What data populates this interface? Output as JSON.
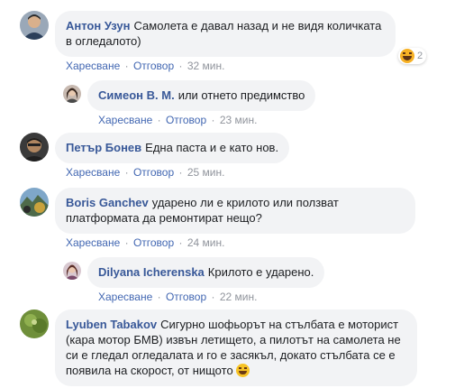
{
  "actions": {
    "like": "Харесване",
    "reply": "Отговор",
    "separator": "·"
  },
  "comments": [
    {
      "author": "Антон Узун",
      "text": "Самолета е давал назад и не видя количката в огледалото)",
      "time": "32 мин.",
      "reaction_count": "2",
      "reaction_icon": "haha-reaction-icon"
    },
    {
      "author": "Симеон В. М.",
      "text": "или отнето предимство",
      "time": "23 мин."
    },
    {
      "author": "Петър Бонев",
      "text": "Една паста и е като нов.",
      "time": "25 мин."
    },
    {
      "author": "Boris Ganchev",
      "text": "ударено ли е крилото или ползват платформата да ремонтират нещо?",
      "time": "24 мин."
    },
    {
      "author": "Dilyana Icherenska",
      "text": "Крилото е ударено.",
      "time": "22 мин."
    },
    {
      "author": "Lyuben Tabakov",
      "text": "Сигурно шофьорът на стълбата е моторист (кара мотор БМВ) извън летището, а пилотът на самолета не си е гледал огледалата и го е засякъл, докато стълбата се е появила на скорост, от нищото",
      "emoji": "grinning-emoji"
    }
  ]
}
